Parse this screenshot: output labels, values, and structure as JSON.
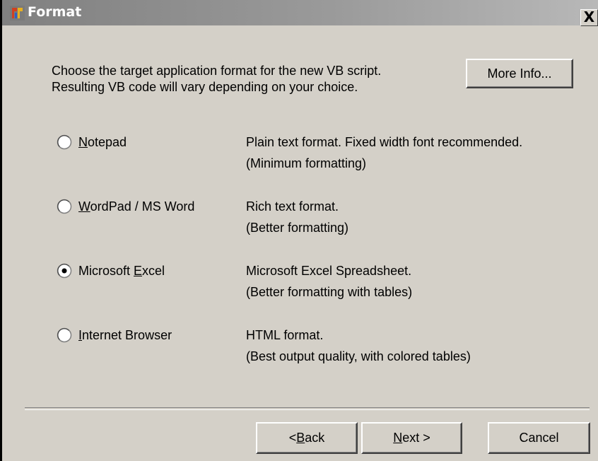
{
  "window": {
    "title": "Format",
    "close_label": "X"
  },
  "intro": {
    "line1": "Choose the target application format for the new VB script.",
    "line2": "Resulting VB code will vary depending on your choice."
  },
  "more_info_label": "More Info...",
  "options": [
    {
      "pre": "",
      "key": "N",
      "post": "otepad",
      "selected": false,
      "desc1": "Plain text format. Fixed width font recommended.",
      "desc2": "(Minimum formatting)"
    },
    {
      "pre": "",
      "key": "W",
      "post": "ordPad / MS Word",
      "selected": false,
      "desc1": "Rich text format.",
      "desc2": "(Better formatting)"
    },
    {
      "pre": "Microsoft ",
      "key": "E",
      "post": "xcel",
      "selected": true,
      "desc1": "Microsoft Excel Spreadsheet.",
      "desc2": "(Better formatting with tables)"
    },
    {
      "pre": "",
      "key": "I",
      "post": "nternet Browser",
      "selected": false,
      "desc1": "HTML format.",
      "desc2": "(Best output quality, with colored tables)"
    }
  ],
  "buttons": {
    "back": {
      "pre": "< ",
      "key": "B",
      "post": "ack"
    },
    "next": {
      "pre": "",
      "key": "N",
      "post": "ext >"
    },
    "cancel": "Cancel"
  }
}
